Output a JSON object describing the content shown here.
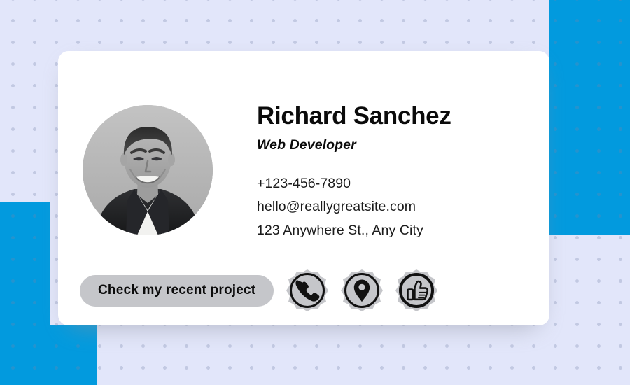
{
  "card": {
    "name": "Richard Sanchez",
    "role": "Web Developer",
    "contacts": [
      {
        "type": "phone",
        "value": "+123-456-7890"
      },
      {
        "type": "email",
        "value": "hello@reallygreatsite.com"
      },
      {
        "type": "address",
        "value": "123 Anywhere St., Any City"
      }
    ],
    "cta_label": "Check my recent project",
    "social_icons": [
      {
        "name": "phone-icon",
        "label": "Phone"
      },
      {
        "name": "location-pin-icon",
        "label": "Location"
      },
      {
        "name": "thumbs-up-icon",
        "label": "Like"
      }
    ],
    "portrait_alt": "Portrait photo of Richard Sanchez, black and white"
  },
  "colors": {
    "background": "#e2e6fa",
    "accent_blue": "#029ade",
    "dot": "#7884aa",
    "card": "#ffffff",
    "button": "#c5c6ca",
    "text": "#0b0b0b",
    "icon_badge_fill": "#c5c6ca"
  }
}
